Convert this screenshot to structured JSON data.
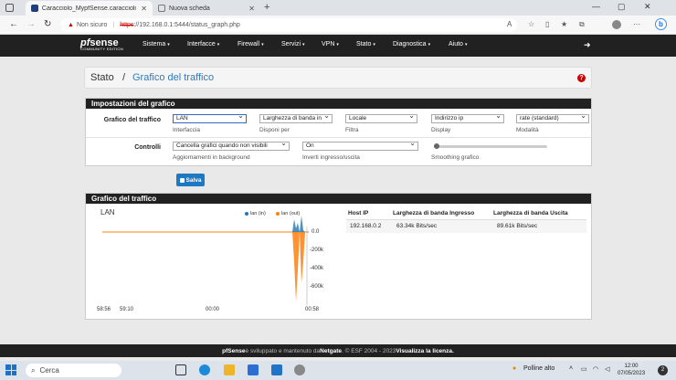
{
  "browser": {
    "tabs": [
      {
        "title": "Caracciolo_MypfSense.caraccioli",
        "active": true
      },
      {
        "title": "Nuova scheda",
        "active": false
      }
    ],
    "url_warning": "Non sicuro",
    "url_scheme": "https",
    "url_rest": "://192.168.0.1:5444/status_graph.php"
  },
  "nav": {
    "logo_pf": "pf",
    "logo_sense": "sense",
    "logo_edition": "COMMUNITY EDITION",
    "menu": [
      "Sistema",
      "Interfacce",
      "Firewall",
      "Servizi",
      "VPN",
      "Stato",
      "Diagnostica",
      "Aiuto"
    ]
  },
  "breadcrumb": {
    "parent": "Stato",
    "separator": "/",
    "current": "Grafico del traffico",
    "help": "?"
  },
  "settings": {
    "title": "Impostazioni del grafico",
    "row1_label": "Grafico del traffico",
    "row1": [
      {
        "value": "LAN",
        "hint": "Interfaccia"
      },
      {
        "value": "Larghezza di banda in",
        "hint": "Disponi per"
      },
      {
        "value": "Locale",
        "hint": "Filtra"
      },
      {
        "value": "Indirizzo ip",
        "hint": "Display"
      },
      {
        "value": "rate (standard)",
        "hint": "Modalità"
      }
    ],
    "row2_label": "Controlli",
    "row2": [
      {
        "value": "Cancella grafici quando non visibili",
        "hint": "Aggiornamenti in background"
      },
      {
        "value": "On",
        "hint": "Inverti ingresso/uscita"
      }
    ],
    "smoothing_hint": "Smoothing grafico",
    "smoothing_level": 0,
    "save_label": "Salva"
  },
  "graph_panel": {
    "title": "Grafico del traffico",
    "table_headers": [
      "Host IP",
      "Larghezza di banda Ingresso",
      "Larghezza di banda Uscita"
    ],
    "rows": [
      {
        "host": "192.168.0.2",
        "in": "63.34k Bits/sec",
        "out": "89.61k Bits/sec"
      }
    ]
  },
  "chart_data": {
    "type": "area",
    "title": "LAN",
    "series": [
      {
        "name": "lan (in)",
        "color": "#1f77b4",
        "x": [
          "00:58"
        ],
        "values": [
          0
        ]
      },
      {
        "name": "lan (out)",
        "color": "#ff7f0e",
        "x": [
          "00:58"
        ],
        "values": [
          0
        ]
      }
    ],
    "y_ticks": [
      "0.0",
      "-200k",
      "-400k",
      "-600k"
    ],
    "x_ticks": [
      "58:56",
      "59:10",
      "00:00",
      "00:58"
    ],
    "ylim": [
      -700000,
      50000
    ],
    "legend_position": "top-right"
  },
  "footer": {
    "brand": "pfSense",
    "text1": "è sviluppato e mantenuto da",
    "company": "Netgate",
    "text2": ". © ESF 2004 - 2023",
    "license": "Visualizza la licenza."
  },
  "taskbar": {
    "search": "Cerca",
    "weather": "Polline alto",
    "time": "12:00",
    "date": "07/05/2023",
    "notif_count": "2"
  }
}
